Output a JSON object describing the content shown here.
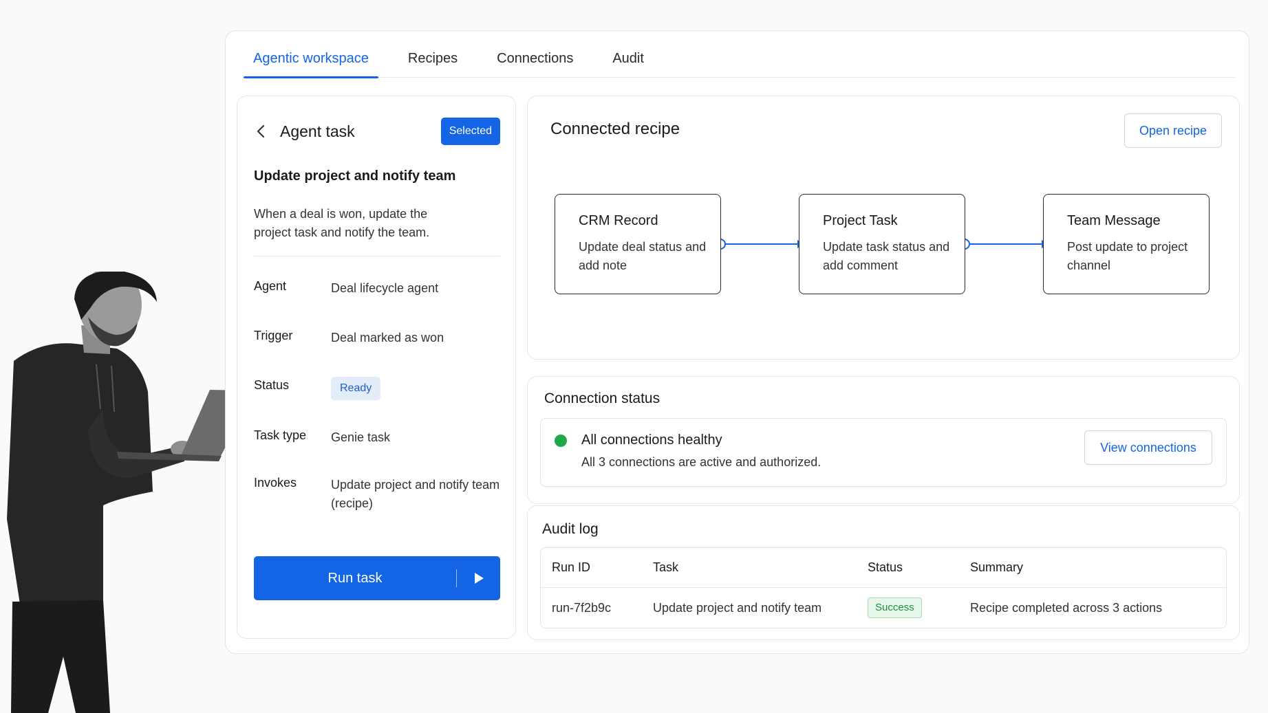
{
  "tabs": [
    {
      "label": "Agentic workspace",
      "active": true
    },
    {
      "label": "Recipes",
      "active": false
    },
    {
      "label": "Connections",
      "active": false
    },
    {
      "label": "Audit",
      "active": false
    }
  ],
  "agent_panel": {
    "title": "Agent task",
    "selected_badge": "Selected",
    "task_title": "Update project and notify team",
    "description": "When a deal is won, update the project task and notify the team.",
    "fields": {
      "agent": {
        "label": "Agent",
        "value": "Deal lifecycle agent"
      },
      "trigger": {
        "label": "Trigger",
        "value": "Deal marked as won"
      },
      "status": {
        "label": "Status",
        "value": "Ready"
      },
      "task_type": {
        "label": "Task type",
        "value": "Genie task"
      },
      "invokes": {
        "label": "Invokes",
        "value": "Update project and notify team (recipe)"
      }
    },
    "run_button": "Run task"
  },
  "recipe": {
    "title": "Connected recipe",
    "open_button": "Open recipe",
    "steps": [
      {
        "title": "CRM Record",
        "desc": "Update deal status and add note"
      },
      {
        "title": "Project Task",
        "desc": "Update task status and add comment"
      },
      {
        "title": "Team Message",
        "desc": "Post update to project channel"
      }
    ]
  },
  "connection_status": {
    "title": "Connection status",
    "headline": "All connections healthy",
    "detail": "All 3 connections are active and authorized.",
    "view_button": "View connections"
  },
  "audit_log": {
    "title": "Audit log",
    "columns": [
      "Run ID",
      "Task",
      "Status",
      "Summary"
    ],
    "rows": [
      {
        "run_id": "run-7f2b9c",
        "task": "Update project and notify team",
        "status": "Success",
        "summary": "Recipe completed across 3 actions"
      }
    ]
  },
  "colors": {
    "accent": "#1464e6",
    "success": "#1ea84a",
    "status_ready_bg": "#e4ecf9"
  }
}
